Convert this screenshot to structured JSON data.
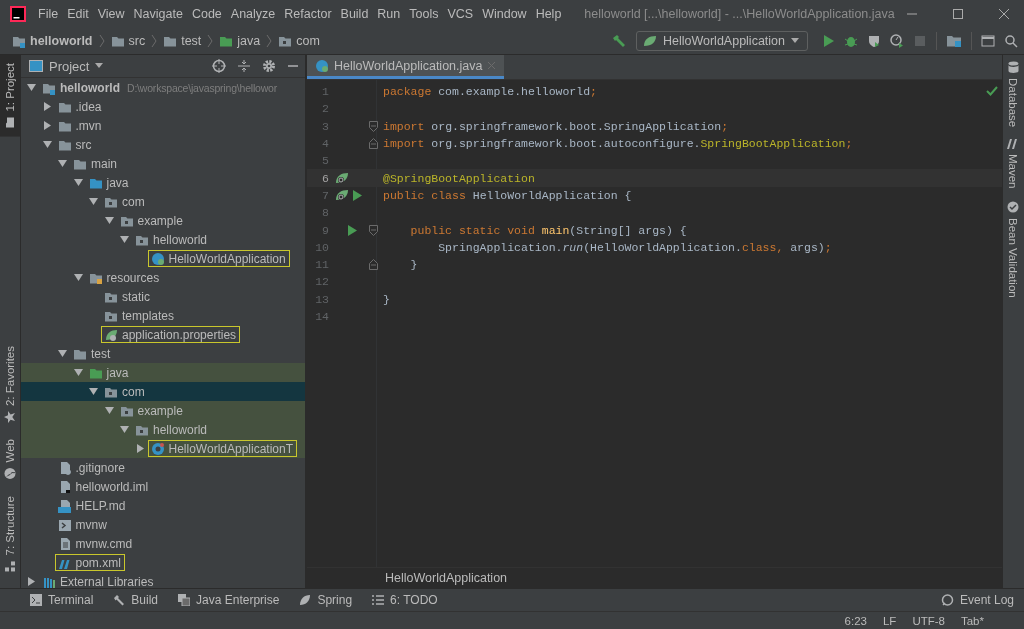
{
  "menu_bar": {
    "menus": [
      "File",
      "Edit",
      "View",
      "Navigate",
      "Code",
      "Analyze",
      "Refactor",
      "Build",
      "Run",
      "Tools",
      "VCS",
      "Window",
      "Help"
    ],
    "title": "helloworld [...\\helloworld] - ...\\HelloWorldApplication.java"
  },
  "nav_bar": {
    "breadcrumbs": [
      {
        "label": "helloworld",
        "kind": "module"
      },
      {
        "label": "src",
        "kind": "folder"
      },
      {
        "label": "test",
        "kind": "folder"
      },
      {
        "label": "java",
        "kind": "test-folder"
      },
      {
        "label": "com",
        "kind": "package"
      }
    ],
    "run_config": "HelloWorldApplication"
  },
  "left_strip": {
    "top": [
      {
        "label": "1: Project",
        "kind": "project",
        "selected": true
      }
    ],
    "bottom": [
      {
        "label": "2: Favorites",
        "kind": "favorites",
        "selected": false
      },
      {
        "label": "Web",
        "kind": "web",
        "selected": false
      },
      {
        "label": "7: Structure",
        "kind": "structure",
        "selected": false
      }
    ]
  },
  "project_panel": {
    "title": "Project",
    "tree": [
      {
        "label": "helloworld",
        "kind": "module",
        "hint": "D:\\workspace\\javaspring\\hellowor",
        "expanded": true,
        "selected": false,
        "boxed": false,
        "tinted": false,
        "children": [
          {
            "label": ".idea",
            "kind": "folder",
            "expanded": false,
            "selected": false,
            "boxed": false,
            "tinted": false
          },
          {
            "label": ".mvn",
            "kind": "folder",
            "expanded": false,
            "selected": false,
            "boxed": false,
            "tinted": false
          },
          {
            "label": "src",
            "kind": "folder",
            "expanded": true,
            "selected": false,
            "boxed": false,
            "tinted": false,
            "children": [
              {
                "label": "main",
                "kind": "folder",
                "expanded": true,
                "selected": false,
                "boxed": false,
                "tinted": false,
                "children": [
                  {
                    "label": "java",
                    "kind": "src-folder",
                    "expanded": true,
                    "selected": false,
                    "boxed": false,
                    "tinted": false,
                    "children": [
                      {
                        "label": "com",
                        "kind": "package",
                        "expanded": true,
                        "selected": false,
                        "boxed": false,
                        "tinted": false,
                        "children": [
                          {
                            "label": "example",
                            "kind": "package",
                            "expanded": true,
                            "selected": false,
                            "boxed": false,
                            "tinted": false,
                            "children": [
                              {
                                "label": "helloworld",
                                "kind": "package",
                                "expanded": true,
                                "selected": false,
                                "boxed": false,
                                "tinted": false,
                                "children": [
                                  {
                                    "label": "HelloWorldApplication",
                                    "kind": "spring-class",
                                    "selected": false,
                                    "boxed": true,
                                    "tinted": false
                                  }
                                ]
                              }
                            ]
                          }
                        ]
                      }
                    ]
                  },
                  {
                    "label": "resources",
                    "kind": "resources-folder",
                    "expanded": true,
                    "selected": false,
                    "boxed": false,
                    "tinted": false,
                    "children": [
                      {
                        "label": "static",
                        "kind": "package",
                        "selected": false,
                        "boxed": false,
                        "tinted": false
                      },
                      {
                        "label": "templates",
                        "kind": "package",
                        "selected": false,
                        "boxed": false,
                        "tinted": false
                      },
                      {
                        "label": "application.properties",
                        "kind": "spring-props",
                        "selected": false,
                        "boxed": true,
                        "tinted": false
                      }
                    ]
                  }
                ]
              },
              {
                "label": "test",
                "kind": "folder",
                "expanded": true,
                "selected": false,
                "boxed": false,
                "tinted": false,
                "children": [
                  {
                    "label": "java",
                    "kind": "test-folder",
                    "expanded": true,
                    "selected": false,
                    "boxed": false,
                    "tinted": true,
                    "children": [
                      {
                        "label": "com",
                        "kind": "package",
                        "expanded": true,
                        "selected": true,
                        "boxed": false,
                        "tinted": true,
                        "children": [
                          {
                            "label": "example",
                            "kind": "package",
                            "expanded": true,
                            "selected": false,
                            "boxed": false,
                            "tinted": true,
                            "children": [
                              {
                                "label": "helloworld",
                                "kind": "package",
                                "expanded": true,
                                "selected": false,
                                "boxed": false,
                                "tinted": true,
                                "children": [
                                  {
                                    "label": "HelloWorldApplicationT",
                                    "kind": "test-class",
                                    "expanded": false,
                                    "selected": false,
                                    "boxed": true,
                                    "tinted": true
                                  }
                                ]
                              }
                            ]
                          }
                        ]
                      }
                    ]
                  }
                ]
              }
            ]
          },
          {
            "label": ".gitignore",
            "kind": "ignore-file",
            "selected": false,
            "boxed": false,
            "tinted": false
          },
          {
            "label": "helloworld.iml",
            "kind": "iml-file",
            "selected": false,
            "boxed": false,
            "tinted": false
          },
          {
            "label": "HELP.md",
            "kind": "md-file",
            "selected": false,
            "boxed": false,
            "tinted": false
          },
          {
            "label": "mvnw",
            "kind": "script-file",
            "selected": false,
            "boxed": false,
            "tinted": false
          },
          {
            "label": "mvnw.cmd",
            "kind": "text-file",
            "selected": false,
            "boxed": false,
            "tinted": false
          },
          {
            "label": "pom.xml",
            "kind": "maven-file",
            "selected": false,
            "boxed": true,
            "tinted": false
          }
        ]
      },
      {
        "label": "External Libraries",
        "kind": "libraries",
        "expanded": false,
        "selected": false,
        "boxed": false,
        "tinted": false
      }
    ]
  },
  "editor": {
    "tabs": [
      {
        "label": "HelloWorldApplication.java",
        "selected": true
      }
    ],
    "lines": [
      {
        "number": "1",
        "current": false,
        "tokens": [
          {
            "text": "package",
            "kind": "kw"
          },
          {
            "text": " com.example.helloworld",
            "kind": "plain"
          },
          {
            "text": ";",
            "kind": "kw"
          }
        ]
      },
      {
        "number": "2",
        "current": false
      },
      {
        "number": "3",
        "current": false,
        "fold_start": true,
        "tokens": [
          {
            "text": "import",
            "kind": "kw"
          },
          {
            "text": " org.springframework.boot.SpringApplication",
            "kind": "plain"
          },
          {
            "text": ";",
            "kind": "kw"
          }
        ]
      },
      {
        "number": "4",
        "current": false,
        "fold_end": true,
        "tokens": [
          {
            "text": "import",
            "kind": "kw"
          },
          {
            "text": " org.springframework.boot.autoconfigure.",
            "kind": "plain"
          },
          {
            "text": "SpringBootApplication",
            "kind": "ann"
          },
          {
            "text": ";",
            "kind": "kw"
          }
        ]
      },
      {
        "number": "5",
        "current": false
      },
      {
        "number": "6",
        "current": true,
        "gutter_icons": [
          {
            "kind": "bean"
          }
        ],
        "tokens": [
          {
            "text": "@SpringBootApplication",
            "kind": "ann"
          }
        ]
      },
      {
        "number": "7",
        "current": false,
        "gutter_icons": [
          {
            "kind": "bean"
          },
          {
            "kind": "run"
          }
        ],
        "tokens": [
          {
            "text": "public class",
            "kind": "kw"
          },
          {
            "text": " HelloWorldApplication {",
            "kind": "plain"
          }
        ]
      },
      {
        "number": "8",
        "current": false
      },
      {
        "number": "9",
        "current": false,
        "gutter_icons": [
          {
            "kind": "run"
          }
        ],
        "fold_start": true,
        "tokens": [
          {
            "text": "    public static void ",
            "kind": "kw"
          },
          {
            "text": "main",
            "kind": "fn"
          },
          {
            "text": "(String[] args) {",
            "kind": "plain"
          }
        ]
      },
      {
        "number": "10",
        "current": false,
        "tokens": [
          {
            "text": "        SpringApplication.",
            "kind": "plain"
          },
          {
            "text": "run",
            "kind": "static"
          },
          {
            "text": "(HelloWorldApplication.",
            "kind": "plain"
          },
          {
            "text": "class, ",
            "kind": "kw"
          },
          {
            "text": "args)",
            "kind": "plain"
          },
          {
            "text": ";",
            "kind": "kw"
          }
        ]
      },
      {
        "number": "11",
        "current": false,
        "fold_end": true,
        "tokens": [
          {
            "text": "    }",
            "kind": "plain"
          }
        ]
      },
      {
        "number": "12",
        "current": false
      },
      {
        "number": "13",
        "current": false,
        "tokens": [
          {
            "text": "}",
            "kind": "plain"
          }
        ]
      },
      {
        "number": "14",
        "current": false
      }
    ],
    "breadcrumb": "HelloWorldApplication"
  },
  "right_strip": [
    {
      "label": "Database",
      "kind": "database"
    },
    {
      "label": "Maven",
      "kind": "maven"
    },
    {
      "label": "Bean Validation",
      "kind": "bean"
    }
  ],
  "tool_bar": {
    "left": [
      {
        "label": "Terminal",
        "kind": "terminal"
      },
      {
        "label": "Build",
        "kind": "build"
      },
      {
        "label": "Java Enterprise",
        "kind": "enterprise"
      },
      {
        "label": "Spring",
        "kind": "spring"
      },
      {
        "label": "6: TODO",
        "kind": "todo"
      }
    ],
    "right": [
      {
        "label": "Event Log",
        "kind": "log"
      }
    ]
  },
  "status_bar": [
    "6:23",
    "LF",
    "UTF-8",
    "Tab*"
  ]
}
